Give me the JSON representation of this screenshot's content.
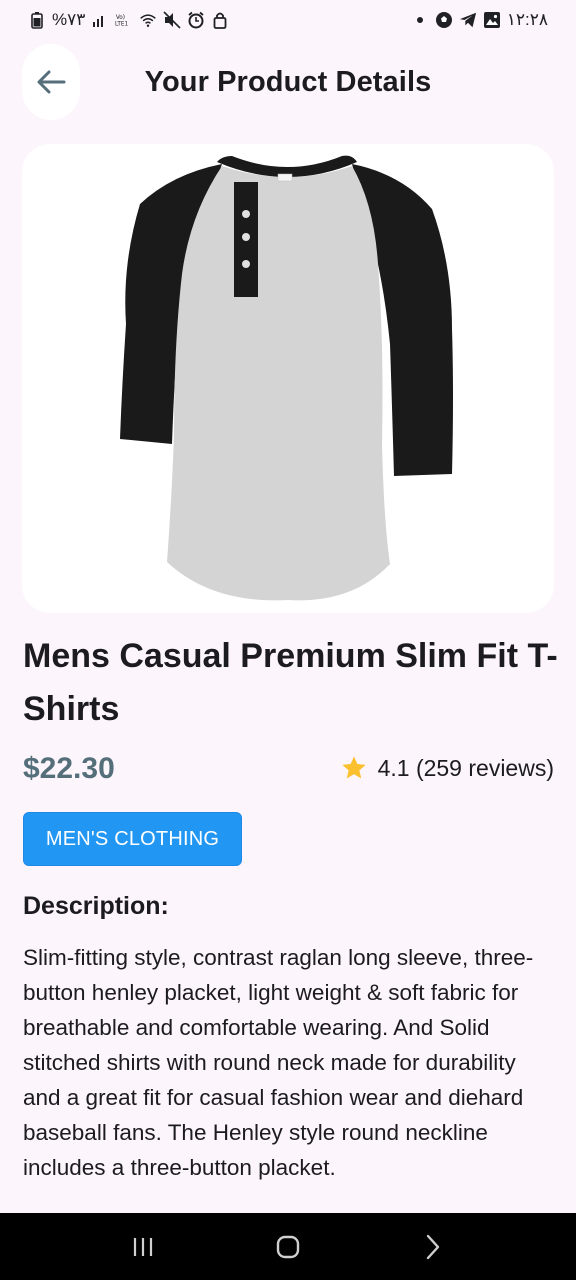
{
  "status_bar": {
    "battery_text": "%۷۳",
    "time": "۱۲:۲۸",
    "left_icons": [
      "battery-icon",
      "signal-icon",
      "volte-icon",
      "wifi-icon",
      "mute-icon",
      "alarm-icon",
      "lock-icon"
    ],
    "right_icons": [
      "dot-icon",
      "soccer-icon",
      "telegram-icon",
      "gallery-icon"
    ]
  },
  "app_bar": {
    "title": "Your Product Details",
    "back_icon": "arrow-left-icon"
  },
  "product": {
    "image_alt": "Henley raglan t-shirt",
    "title": "Mens Casual Premium Slim Fit T-Shirts",
    "price": "$22.30",
    "rating_text": "4.1 (259 reviews)",
    "category": "MEN'S CLOTHING",
    "description_heading": "Description:",
    "description": "Slim-fitting style, contrast raglan long sleeve, three-button henley placket, light weight & soft fabric for breathable and comfortable wearing. And Solid stitched shirts with round neck made for durability and a great fit for casual fashion wear and diehard baseball fans. The Henley style round neckline includes a three-button placket."
  },
  "nav_bar": {
    "buttons": [
      "recents-icon",
      "home-icon",
      "back-chevron-icon"
    ]
  },
  "colors": {
    "background": "#fcf5fc",
    "price": "#546e7a",
    "chip": "#2196f3",
    "star": "#fbc02d",
    "back_arrow": "#546e7a"
  }
}
